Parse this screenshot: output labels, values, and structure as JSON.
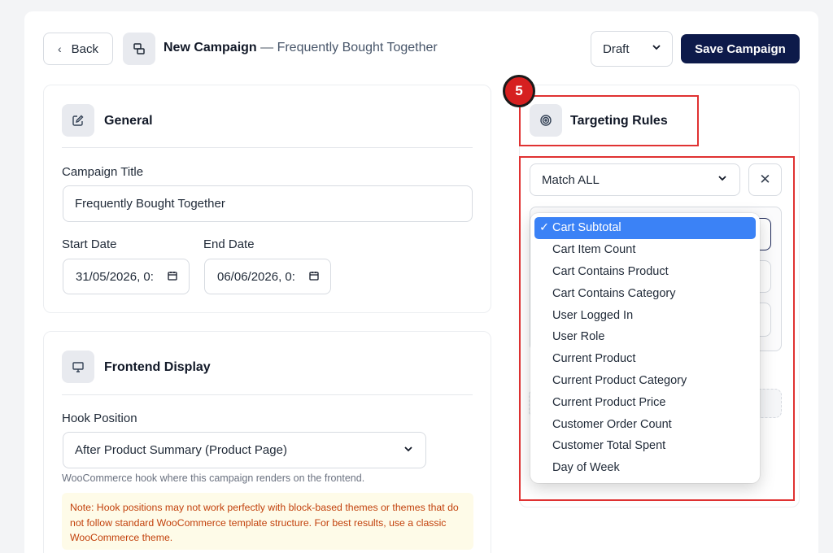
{
  "header": {
    "back_label": "Back",
    "title": "New Campaign",
    "separator": " — ",
    "subtitle": "Frequently Bought Together",
    "status_value": "Draft",
    "save_label": "Save Campaign"
  },
  "general": {
    "title": "General",
    "campaign_title_label": "Campaign Title",
    "campaign_title_value": "Frequently Bought Together",
    "start_date_label": "Start Date",
    "start_date_value": "31/05/2026, 0:",
    "end_date_label": "End Date",
    "end_date_value": "06/06/2026, 0:"
  },
  "frontend": {
    "title": "Frontend Display",
    "hook_label": "Hook Position",
    "hook_value": "After Product Summary (Product Page)",
    "hook_help": "WooCommerce hook where this campaign renders on the frontend.",
    "note": "Note: Hook positions may not work perfectly with block-based themes or themes that do not follow standard WooCommerce template structure. For best results, use a classic WooCommerce theme."
  },
  "targeting": {
    "step_number": "5",
    "title": "Targeting Rules",
    "match_value": "Match ALL",
    "options": [
      "Cart Subtotal",
      "Cart Item Count",
      "Cart Contains Product",
      "Cart Contains Category",
      "User Logged In",
      "User Role",
      "Current Product",
      "Current Product Category",
      "Current Product Price",
      "Customer Order Count",
      "Customer Total Spent",
      "Day of Week"
    ],
    "selected_index": 0
  },
  "colors": {
    "primary_button": "#0d1a4a",
    "highlight": "#e03232",
    "selected_option": "#3b82f6",
    "note_text": "#c2410c",
    "note_bg": "#fefbe8"
  },
  "icons": {
    "back": "chevron-left-icon",
    "campaign": "campaign-icon",
    "status": "chevron-down-icon",
    "general": "edit-icon",
    "frontend": "monitor-icon",
    "targeting": "target-icon",
    "close": "close-icon"
  }
}
